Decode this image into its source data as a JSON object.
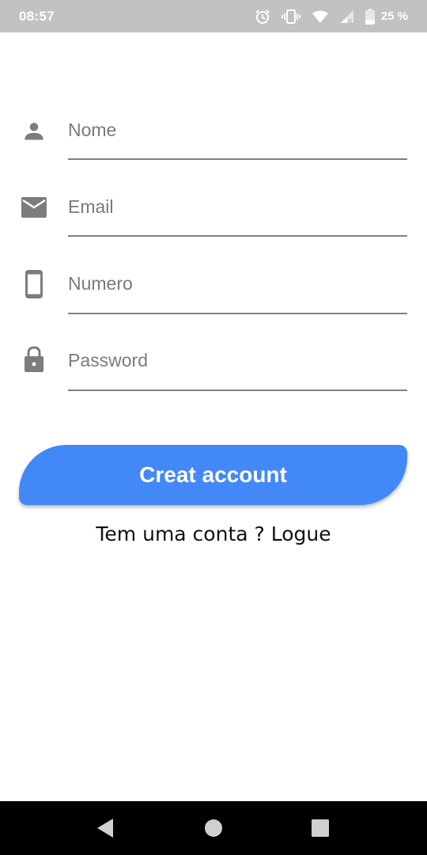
{
  "status_bar": {
    "time": "08:57",
    "battery": "25 %",
    "icons": [
      "alarm-icon",
      "vibrate-icon",
      "wifi-icon",
      "signal-icon",
      "battery-icon"
    ]
  },
  "form": {
    "fields": [
      {
        "name": "name",
        "placeholder": "Nome",
        "value": "",
        "icon": "person-icon"
      },
      {
        "name": "email",
        "placeholder": "Email",
        "value": "",
        "icon": "mail-icon"
      },
      {
        "name": "number",
        "placeholder": "Numero",
        "value": "",
        "icon": "phone-icon"
      },
      {
        "name": "password",
        "placeholder": "Password",
        "value": "",
        "icon": "lock-icon"
      }
    ],
    "submit_label": "Creat account",
    "login_text": "Tem uma conta ? Logue"
  },
  "colors": {
    "accent": "#4388f7",
    "status_bar": "#c2c2c2",
    "icon": "#7c7c7c",
    "underline": "#7f7f7f",
    "nav_bar": "#000000"
  },
  "nav_bar": {
    "buttons": [
      "back-icon",
      "home-icon",
      "recents-icon"
    ]
  }
}
